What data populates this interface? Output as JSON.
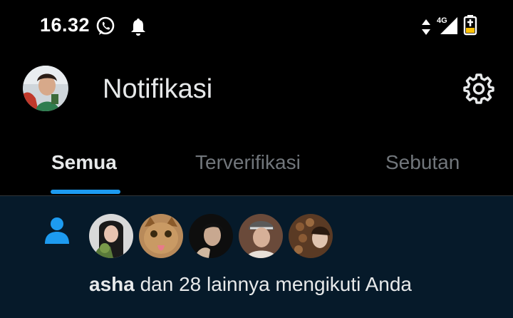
{
  "status_bar": {
    "time": "16.32",
    "network_label": "4G",
    "icons": [
      "whatsapp-icon",
      "bell-icon",
      "data-arrows-icon",
      "signal-icon",
      "battery-charging-icon"
    ]
  },
  "header": {
    "title": "Notifikasi",
    "settings_icon": "gear-icon"
  },
  "tabs": [
    {
      "label": "Semua",
      "active": true
    },
    {
      "label": "Terverifikasi",
      "active": false
    },
    {
      "label": "Sebutan",
      "active": false
    }
  ],
  "notification": {
    "type_icon": "person-icon",
    "user": "asha",
    "message": " dan 28 lainnya mengikuti Anda",
    "avatar_count": 5
  },
  "colors": {
    "background": "#000000",
    "accent": "#1d9bf0",
    "notification_bg": "#061a2a",
    "inactive_tab": "#71767b",
    "text": "#e7e9ea"
  }
}
